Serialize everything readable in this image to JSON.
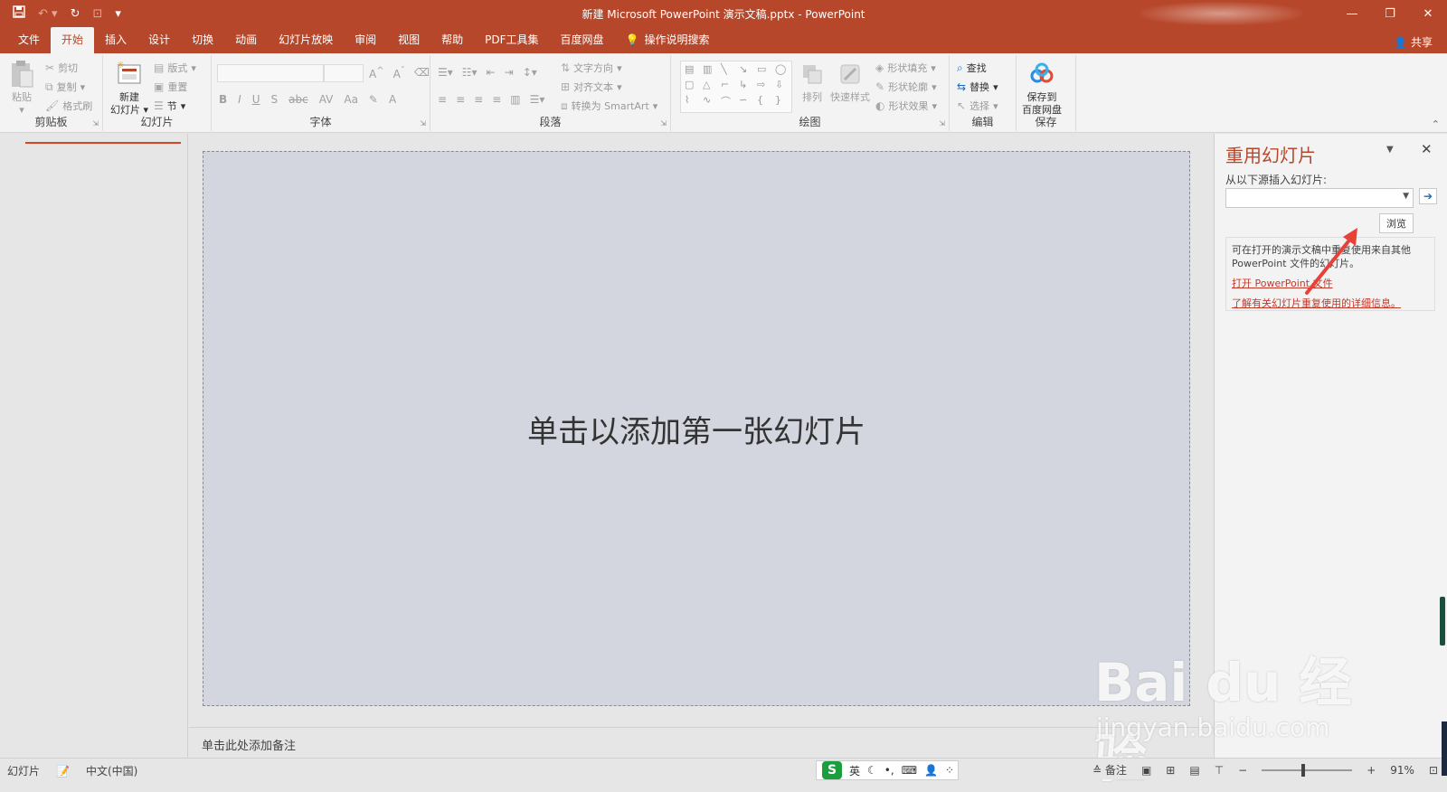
{
  "window": {
    "title": "新建 Microsoft PowerPoint 演示文稿.pptx  -  PowerPoint",
    "minimize": "—",
    "restore": "❐",
    "close": "✕"
  },
  "qat": {
    "save_icon": "save-icon",
    "undo_icon": "undo-icon",
    "redo_icon": "redo-icon",
    "start_icon": "start-icon",
    "customize": "▾"
  },
  "tabs": [
    {
      "label": "文件"
    },
    {
      "label": "开始"
    },
    {
      "label": "插入"
    },
    {
      "label": "设计"
    },
    {
      "label": "切换"
    },
    {
      "label": "动画"
    },
    {
      "label": "幻灯片放映"
    },
    {
      "label": "审阅"
    },
    {
      "label": "视图"
    },
    {
      "label": "帮助"
    },
    {
      "label": "PDF工具集"
    },
    {
      "label": "百度网盘"
    }
  ],
  "tell_me": "操作说明搜索",
  "share": "共享",
  "ribbon": {
    "clipboard": {
      "label": "剪贴板",
      "paste": "粘贴",
      "cut": "剪切",
      "copy": "复制",
      "format_painter": "格式刷"
    },
    "slides": {
      "label": "幻灯片",
      "new_slide_line1": "新建",
      "new_slide_line2": "幻灯片",
      "layout": "版式",
      "reset": "重置",
      "section": "节"
    },
    "font": {
      "label": "字体",
      "bold": "B",
      "italic": "I",
      "underline": "U",
      "shadow": "S",
      "strike": "abc",
      "spacing": "AV",
      "case": "Aa",
      "grow": "A",
      "shrink": "A"
    },
    "paragraph": {
      "label": "段落",
      "text_direction": "文字方向",
      "align_text": "对齐文本",
      "smartart": "转换为 SmartArt"
    },
    "drawing": {
      "label": "绘图",
      "arrange": "排列",
      "quick_styles": "快速样式",
      "shape_fill": "形状填充",
      "shape_outline": "形状轮廓",
      "shape_effects": "形状效果"
    },
    "editing": {
      "label": "编辑",
      "find": "查找",
      "replace": "替换",
      "select": "选择"
    },
    "save": {
      "label": "保存",
      "save_line1": "保存到",
      "save_line2": "百度网盘"
    }
  },
  "slide": {
    "placeholder": "单击以添加第一张幻灯片"
  },
  "notes": {
    "placeholder": "单击此处添加备注"
  },
  "reuse_pane": {
    "title": "重用幻灯片",
    "source_label": "从以下源插入幻灯片:",
    "source_value": "",
    "browse": "浏览",
    "info_text": "可在打开的演示文稿中重复使用来自其他 PowerPoint 文件的幻灯片。",
    "open_link": "打开 PowerPoint 文件",
    "learn_link": "了解有关幻灯片重复使用的详细信息。"
  },
  "status": {
    "slide": "幻灯片",
    "language": "中文(中国)",
    "notes": "备注",
    "zoom": "91%",
    "ime_lang": "英"
  },
  "watermark": {
    "line1": "Bai du 经验",
    "line2": "jingyan.baidu.com"
  },
  "colors": {
    "accent": "#b7472a",
    "link": "#c0392b",
    "slide_bg": "#d3d6de"
  }
}
